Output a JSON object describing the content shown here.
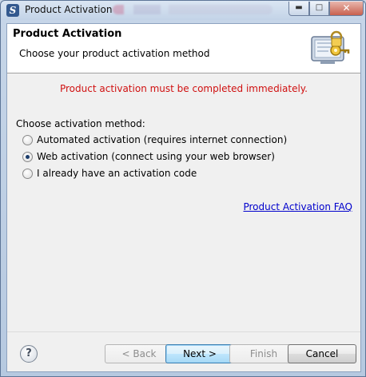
{
  "window": {
    "title": "Product Activation",
    "app_icon_glyph": "S"
  },
  "header": {
    "title": "Product Activation",
    "subtitle": "Choose your product activation method",
    "icon": "keyring-computer-icon"
  },
  "main": {
    "error_message": "Product activation must be completed immediately.",
    "method_label": "Choose activation method:",
    "options": [
      {
        "label": "Automated activation (requires internet connection)",
        "checked": false
      },
      {
        "label": "Web activation (connect using your web browser)",
        "checked": true
      },
      {
        "label": "I already have an activation code",
        "checked": false
      }
    ],
    "faq_link": "Product Activation FAQ"
  },
  "footer": {
    "help_glyph": "?",
    "back_label": "< Back",
    "next_label": "Next >",
    "finish_label": "Finish",
    "cancel_label": "Cancel"
  },
  "colors": {
    "error": "#d01010",
    "link": "#0000cc",
    "primary_border": "#3c7fb1"
  }
}
